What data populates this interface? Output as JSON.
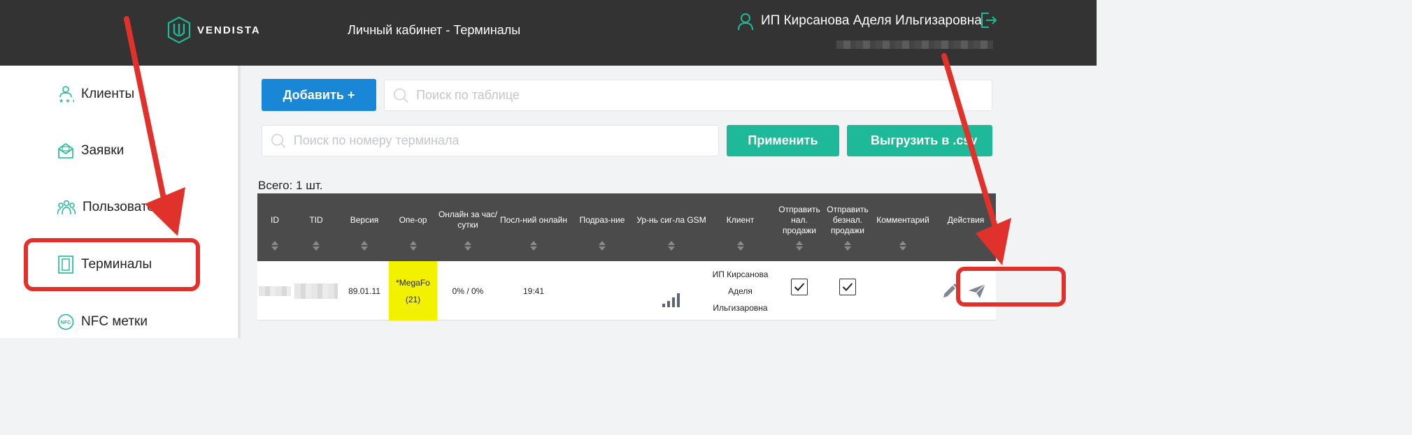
{
  "header": {
    "logo_text": "VENDISTA",
    "page_title": "Личный кабинет - Терминалы",
    "user_name": "ИП Кирсанова Аделя Ильгизаровна"
  },
  "sidebar": {
    "items": [
      {
        "label": "Клиенты",
        "icon": "clients-icon"
      },
      {
        "label": "Заявки",
        "icon": "requests-icon"
      },
      {
        "label": "Пользователи",
        "icon": "users-icon"
      },
      {
        "label": "Терминалы",
        "icon": "terminal-icon"
      },
      {
        "label": "NFC метки",
        "icon": "nfc-icon"
      }
    ]
  },
  "toolbar": {
    "add_label": "Добавить +",
    "search_placeholder": "Поиск по таблице",
    "terminal_search_placeholder": "Поиск по номеру терминала",
    "apply_label": "Применить",
    "export_label": "Выгрузить в .csv"
  },
  "total_label": "Всего: 1 шт.",
  "table": {
    "columns": [
      "ID",
      "TID",
      "Версия",
      "Опе-ор",
      "Онлайн за час/ сутки",
      "Посл-ний онлайн",
      "Подраз-ние",
      "Ур-нь сиг-ла GSM",
      "Клиент",
      "Отправить нал. продажи",
      "Отправить безнал. продажи",
      "Комментарий",
      "Действия"
    ],
    "row": {
      "version": "89.01.11",
      "operator_line1": "*MegaFo",
      "operator_line2": "(21)",
      "online": "0% / 0%",
      "last_online": "19:41",
      "client_line1": "ИП Кирсанова",
      "client_line2": "Аделя",
      "client_line3": "Ильгизаровна",
      "send_cash": true,
      "send_cashless": true,
      "gsm_level_bars": 4
    }
  },
  "colors": {
    "header_bg": "#333333",
    "accent_green": "#1db998",
    "accent_blue": "#1a87d6",
    "operator_highlight": "#f2f200",
    "annotation_red": "#e0322b"
  }
}
